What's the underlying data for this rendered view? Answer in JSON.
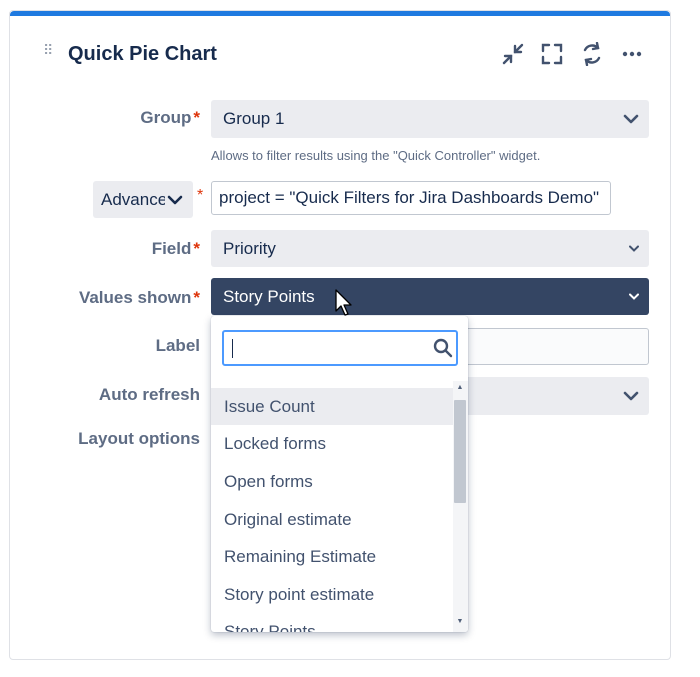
{
  "widget": {
    "title": "Quick Pie Chart"
  },
  "form": {
    "group": {
      "label": "Group",
      "value": "Group 1",
      "help": "Allows to filter results using the \"Quick Controller\" widget."
    },
    "query": {
      "mode_label": "Advanced",
      "value": "project = \"Quick Filters for Jira Dashboards Demo\""
    },
    "field": {
      "label": "Field",
      "value": "Priority"
    },
    "values_shown": {
      "label": "Values shown",
      "value": "Story Points"
    },
    "label_field": {
      "label": "Label"
    },
    "auto_refresh": {
      "label": "Auto refresh"
    },
    "layout_options": {
      "label": "Layout options"
    },
    "required_mark": "*"
  },
  "dropdown": {
    "search_value": "",
    "options": [
      "Issue Count",
      "Locked forms",
      "Open forms",
      "Original estimate",
      "Remaining Estimate",
      "Story point estimate",
      "Story Points"
    ],
    "highlighted_index": 0
  },
  "colors": {
    "accent": "#1f7ae0",
    "selected_bg": "#344563",
    "required": "#de350b"
  }
}
